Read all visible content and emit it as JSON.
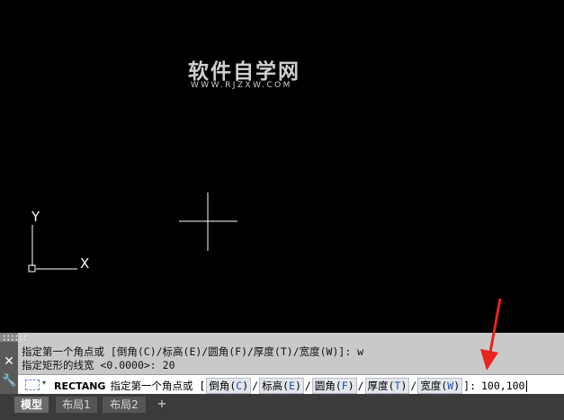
{
  "watermark": {
    "title": "软件自学网",
    "url": "WWW.RJZXW.COM"
  },
  "ucs": {
    "x_label": "X",
    "y_label": "Y"
  },
  "history": [
    "指定第一个角点或 [倒角(C)/标高(E)/圆角(F)/厚度(T)/宽度(W)]: w",
    "指定矩形的线宽 <0.0000>: 20"
  ],
  "command": {
    "name": "RECTANG",
    "prompt": "指定第一个角点或 [",
    "options": [
      {
        "label": "倒角",
        "open": "(",
        "key": "C",
        "close": ")"
      },
      {
        "label": "标高",
        "open": "(",
        "key": "E",
        "close": ")"
      },
      {
        "label": "圆角",
        "open": "(",
        "key": "F",
        "close": ")"
      },
      {
        "label": "厚度",
        "open": "(",
        "key": "T",
        "close": ")"
      },
      {
        "label": "宽度",
        "open": "(",
        "key": "W",
        "close": ")"
      }
    ],
    "separator": "/",
    "suffix": "]:",
    "input": "100,100"
  },
  "panel": {
    "close_glyph": "✕",
    "settings_glyph": "🔧"
  },
  "tabs": [
    "模型",
    "布局1",
    "布局2"
  ],
  "tab_add": "+",
  "colors": {
    "annotation_arrow": "#e8241c",
    "option_key": "#1a55b5"
  }
}
